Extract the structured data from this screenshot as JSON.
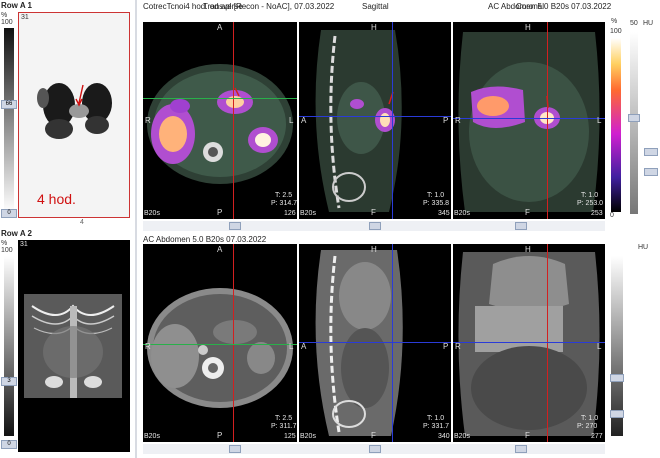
{
  "left_column": {
    "row1": {
      "title": "Row A 1",
      "index": "31",
      "scale_unit": "%",
      "scale_max": "100",
      "scale_mid": "66",
      "scale_min": "0",
      "annotation": "4 hod.",
      "bottom_mark": "4"
    },
    "row2": {
      "title": "Row A 2",
      "index": "31",
      "scale_unit": "%",
      "scale_max": "100",
      "scale_mid": "3",
      "scale_min": "0"
    }
  },
  "top_panel": {
    "series_label": "CotrecTcnoi4 hod. od apl [Recon - NoAC], 07.03.2022",
    "right_label": "AC Abdomen 5.0 B20s 07.03.2022",
    "view_titles": [
      "Transverse",
      "Sagittal",
      "Coronal"
    ],
    "views": [
      {
        "top": "A",
        "left": "R",
        "right": "L",
        "bottom": "P",
        "t": "T: 2.5",
        "p": "P: 314.7",
        "series": "B20s",
        "slice": "126"
      },
      {
        "top": "H",
        "left": "A",
        "right": "P",
        "bottom": "F",
        "t": "T: 1.0",
        "p": "P: 335.8",
        "series": "B20s",
        "slice": "345"
      },
      {
        "top": "H",
        "left": "R",
        "right": "L",
        "bottom": "F",
        "t": "T: 1.0",
        "p": "P: 253.0",
        "series": "B20s",
        "slice": "253"
      }
    ],
    "colorbar": {
      "unit": "%",
      "max": "100",
      "min": "0",
      "right_top": "50",
      "right_unit": "HU"
    }
  },
  "bottom_panel": {
    "series_label": "AC Abdomen 5.0 B20s 07.03.2022",
    "views": [
      {
        "top": "A",
        "left": "R",
        "right": "L",
        "bottom": "P",
        "t": "T: 2.5",
        "p": "P: 311.7",
        "series": "B20s",
        "slice": "125"
      },
      {
        "top": "H",
        "left": "A",
        "right": "P",
        "bottom": "F",
        "t": "T: 1.0",
        "p": "P: 331.7",
        "series": "B20s",
        "slice": "340"
      },
      {
        "top": "H",
        "left": "R",
        "right": "L",
        "bottom": "F",
        "t": "T: 1.0",
        "p": "P: 270",
        "series": "B20s",
        "slice": "277"
      }
    ],
    "colorbar": {
      "unit": "HU"
    }
  },
  "colors": {
    "crosshair_red": "#d22020",
    "crosshair_green": "#29b04a",
    "crosshair_blue": "#2a3bd8",
    "pet_hot": "#ff3ad0",
    "accent_annot": "#d01010"
  }
}
